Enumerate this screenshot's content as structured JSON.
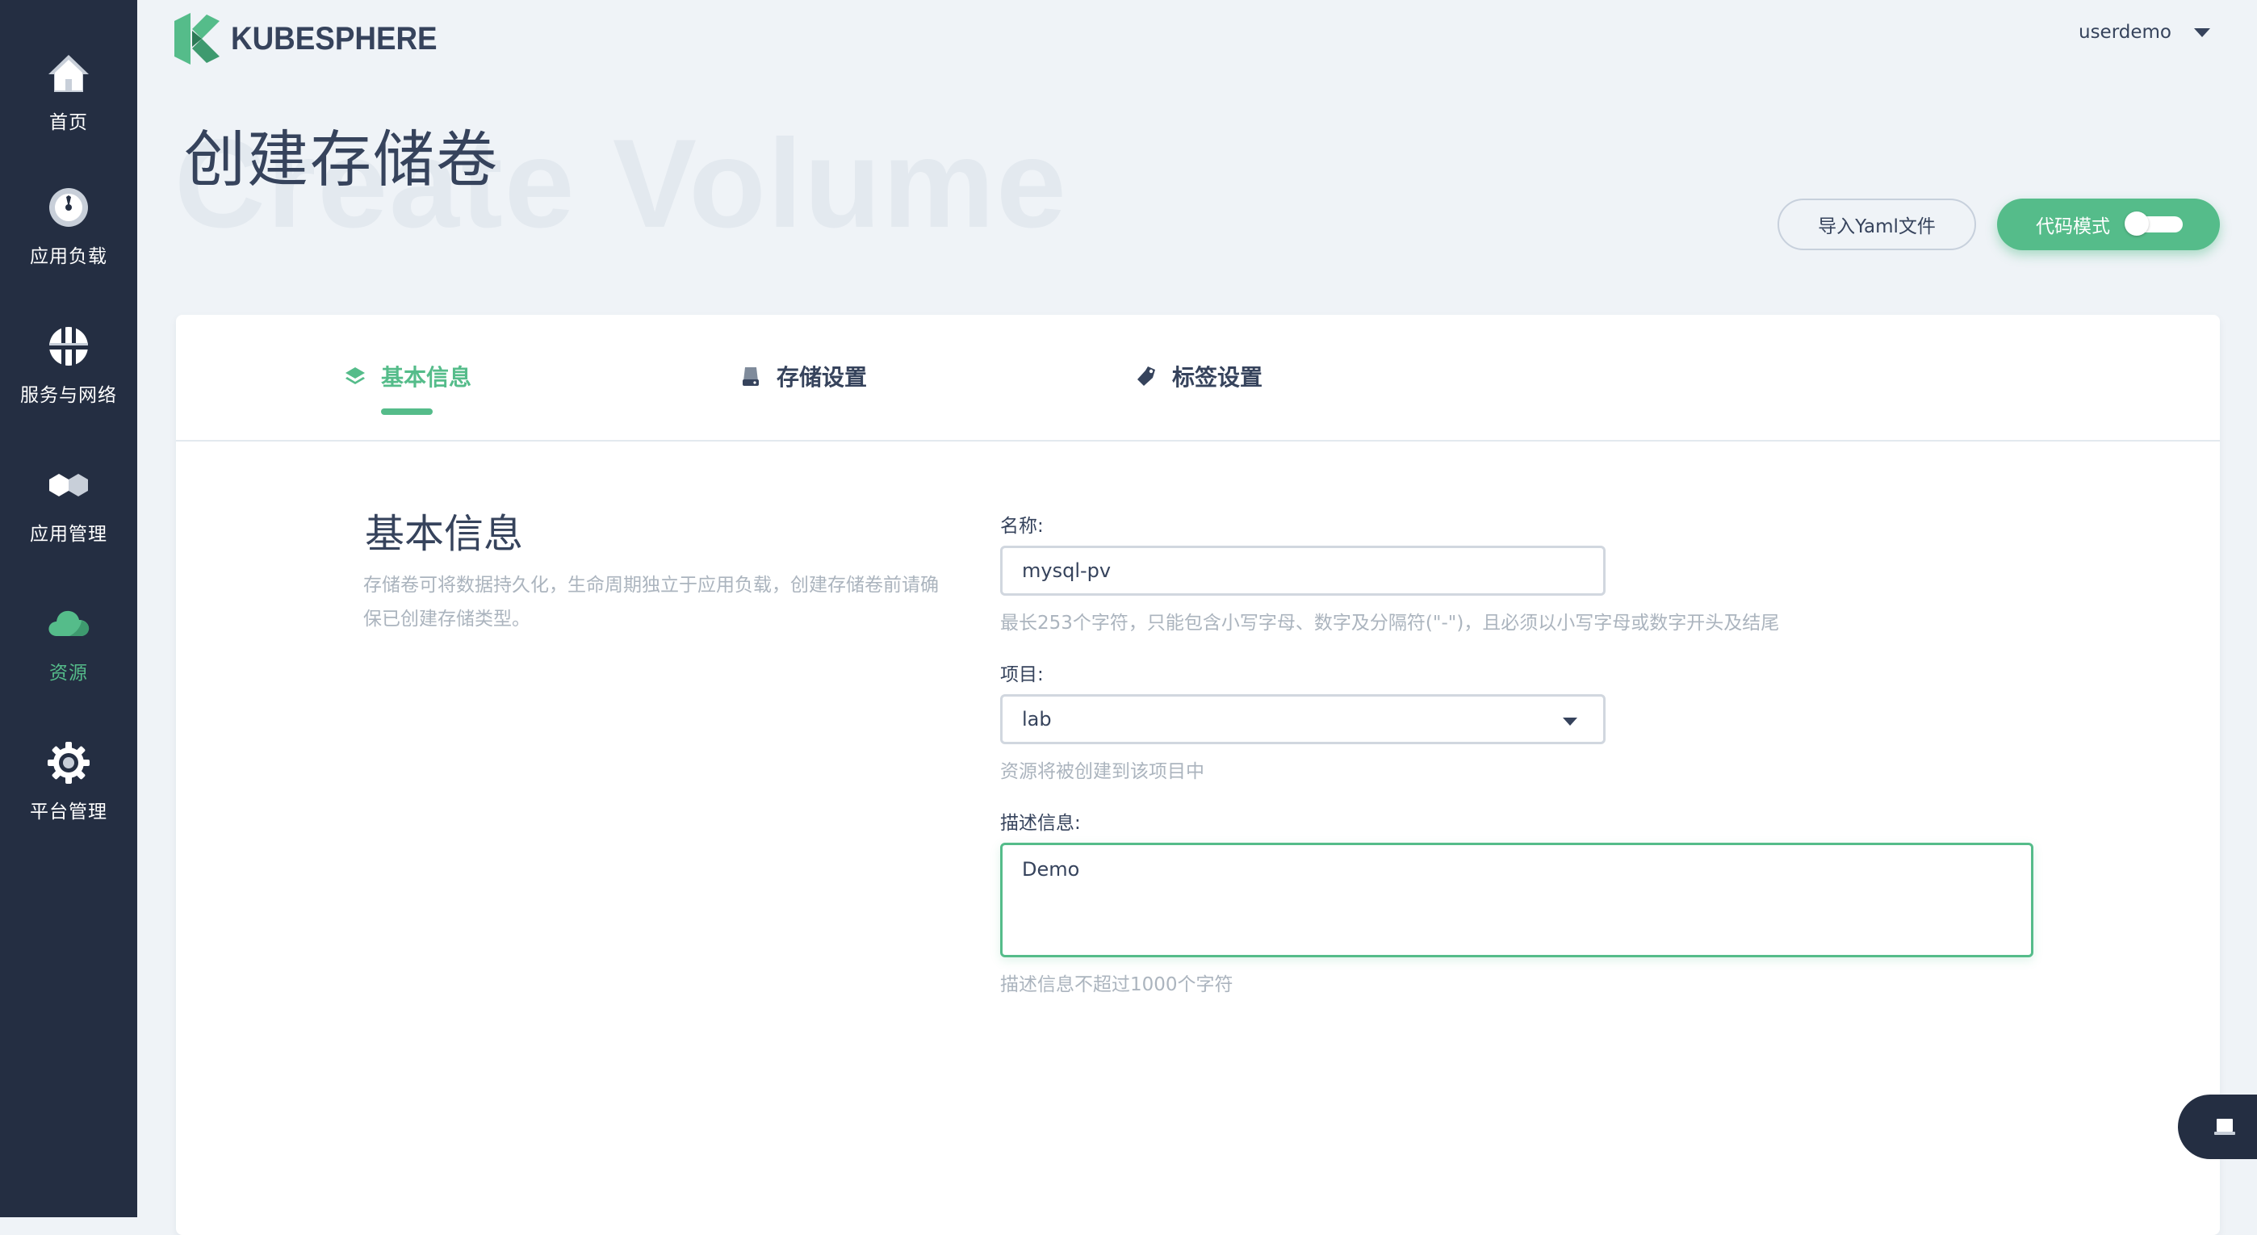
{
  "brand": {
    "name": "KUBESPHERE"
  },
  "user": {
    "name": "userdemo"
  },
  "sidebar": {
    "items": [
      {
        "label": "首页",
        "icon": "home-icon"
      },
      {
        "label": "应用负载",
        "icon": "dashboard-icon"
      },
      {
        "label": "服务与网络",
        "icon": "network-icon"
      },
      {
        "label": "应用管理",
        "icon": "appstore-icon"
      },
      {
        "label": "资源",
        "icon": "cloud-icon",
        "active": true
      },
      {
        "label": "平台管理",
        "icon": "gear-icon"
      }
    ]
  },
  "page": {
    "title": "创建存储卷",
    "bg_title": "Create Volume"
  },
  "actions": {
    "import_yaml": "导入Yaml文件",
    "code_mode": "代码模式"
  },
  "tabs": [
    {
      "label": "基本信息",
      "icon": "layers-icon",
      "active": true
    },
    {
      "label": "存储设置",
      "icon": "storage-icon"
    },
    {
      "label": "标签设置",
      "icon": "tag-icon"
    }
  ],
  "section": {
    "title": "基本信息",
    "description_line1": "存储卷可将数据持久化，生命周期独立于应用负载，创建存储卷前请确",
    "description_line2": "保已创建存储类型。"
  },
  "form": {
    "name_label": "名称:",
    "name_value": "mysql-pv",
    "name_hint": "最长253个字符，只能包含小写字母、数字及分隔符(\"-\")，且必须以小写字母或数字开头及结尾",
    "project_label": "项目:",
    "project_value": "lab",
    "project_hint": "资源将被创建到该项目中",
    "desc_label": "描述信息:",
    "desc_value": "Demo",
    "desc_hint": "描述信息不超过1000个字符"
  },
  "colors": {
    "sidebar_bg": "#242e42",
    "accent": "#55bc8a",
    "page_bg": "#eff3f7",
    "text": "#36435c",
    "muted": "#abb4be"
  }
}
